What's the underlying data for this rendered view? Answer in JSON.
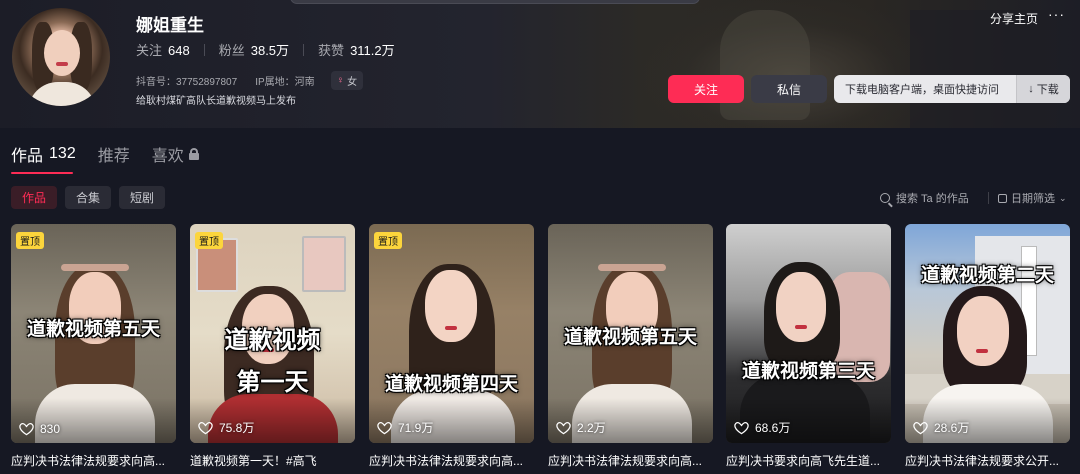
{
  "profile": {
    "name": "娜姐重生",
    "stats": [
      {
        "label": "关注",
        "value": "648"
      },
      {
        "label": "粉丝",
        "value": "38.5万"
      },
      {
        "label": "获赞",
        "value": "311.2万"
      }
    ],
    "douyin_id": "抖音号：37752897807",
    "ip_location": "IP属地：河南",
    "gender": "女",
    "bio": "给耿村煤矿高队长道歉视频马上发布"
  },
  "actions": {
    "share_label": "分享主页",
    "more_label": "···",
    "follow_label": "关注",
    "message_label": "私信",
    "download_prompt": "下载电脑客户端，桌面快捷访问",
    "download_label": "下载"
  },
  "tabs": [
    {
      "label": "作品",
      "count": "132",
      "active": true
    },
    {
      "label": "推荐",
      "count": "",
      "active": false
    },
    {
      "label": "喜欢",
      "count": "",
      "active": false,
      "locked": true
    }
  ],
  "subtabs": [
    {
      "label": "作品",
      "active": true
    },
    {
      "label": "合集",
      "active": false
    },
    {
      "label": "短剧",
      "active": false
    }
  ],
  "filters": {
    "search_label": "搜索 Ta 的作品",
    "date_filter_label": "日期筛选"
  },
  "videos": [
    {
      "pinned": true,
      "pin_label": "置顶",
      "overlay": "道歉视频第五天",
      "likes": "830",
      "caption": "应判决书法律法规要求向高..."
    },
    {
      "pinned": true,
      "pin_label": "置顶",
      "overlay": "道歉视频",
      "overlay2": "第一天",
      "likes": "75.8万",
      "caption": "道歉视频第一天！#高飞"
    },
    {
      "pinned": true,
      "pin_label": "置顶",
      "overlay": "道歉视频第四天",
      "likes": "71.9万",
      "caption": "应判决书法律法规要求向高..."
    },
    {
      "pinned": false,
      "pin_label": "",
      "overlay": "道歉视频第五天",
      "likes": "2.2万",
      "caption": "应判决书法律法规要求向高..."
    },
    {
      "pinned": false,
      "pin_label": "",
      "overlay": "道歉视频第三天",
      "likes": "68.6万",
      "caption": "应判决书要求向高飞先生道..."
    },
    {
      "pinned": false,
      "pin_label": "",
      "overlay": "道歉视频第二天",
      "likes": "28.6万",
      "caption": "应判决书法律法规要求公开..."
    }
  ],
  "colors": {
    "accent": "#fe2c55",
    "background": "#161823",
    "pin": "#fcd53c"
  }
}
